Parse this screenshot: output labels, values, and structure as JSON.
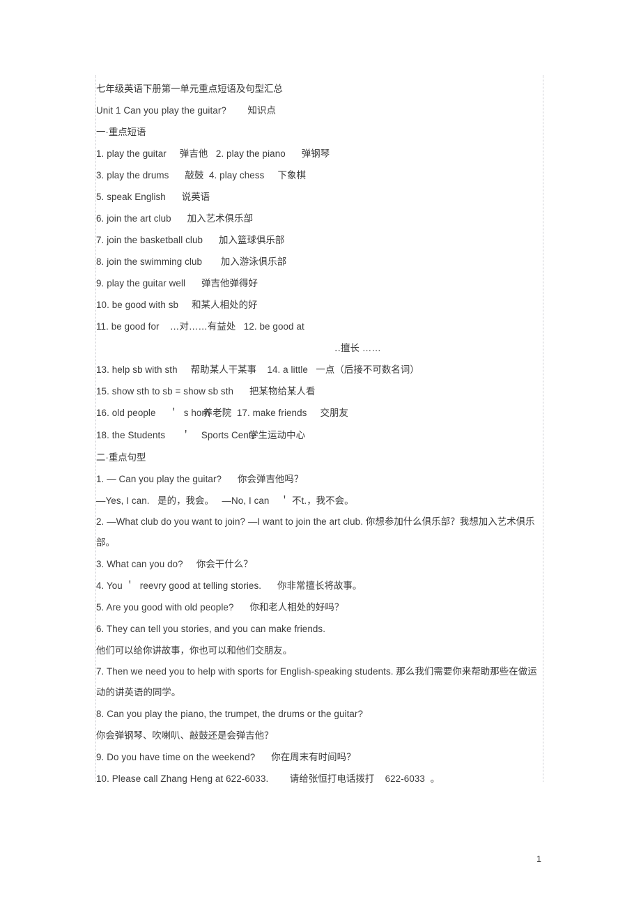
{
  "document": {
    "title": "七年级英语下册第一单元重点短语及句型汇总",
    "unit_heading": "Unit 1 Can you play the guitar?        知识点",
    "page_number": "1",
    "text_color": "#3a3a3a",
    "rule_color": "#c9c9cf",
    "background": "#ffffff"
  },
  "section_phrases": {
    "heading": "一·重点短语",
    "lines": [
      "1. play the guitar     弹吉他   2. play the piano      弹钢琴",
      "3. play the drums      敲鼓  4. play chess     下象棋",
      "5. speak English      说英语",
      "6. join the art club      加入艺术俱乐部",
      "7. join the basketball club      加入篮球俱乐部",
      "8. join the swimming club       加入游泳俱乐部",
      "9. play the guitar well      弹吉他弹得好",
      "10. be good with sb     和某人相处的好",
      "11. be good for    …对……有益处   12. be good at",
      "13. help sb with sth     帮助某人干某事    14. a little   一点（后接不可数名词）",
      "15. show sth to sb = show sb sth      把某物给某人看"
    ],
    "line_12_translation": "‥擅长 ……",
    "line_16": {
      "latin": "16. old people     ＇  s hom",
      "overlap_zh": "养老院",
      "tail": "  17. make friends     交朋友"
    },
    "line_18": {
      "latin": "18. the Students      ＇    Sports Cente",
      "overlap_zh": "学生运动中心"
    }
  },
  "section_sentences": {
    "heading": "二·重点句型",
    "items": [
      {
        "id": "s1a",
        "text": "1. — Can you play the guitar?      你会弹吉他吗？"
      },
      {
        "id": "s1b",
        "text": "—Yes, I can.   是的，我会。   —No, I can    ＇ 不t.，我不会。"
      },
      {
        "id": "s2",
        "text": "2. —What club do you want to join?       —I want to join the art club.      你想参加什么俱乐部？我想加入艺术俱乐部。"
      },
      {
        "id": "s3",
        "text": "3. What can you do?     你会干什么？"
      },
      {
        "id": "s4",
        "text": "4. You ＇  reevry good at telling stories.      你非常擅长将故事。"
      },
      {
        "id": "s5",
        "text": "5. Are you good with old people?      你和老人相处的好吗？"
      },
      {
        "id": "s6a",
        "text": "6. They can tell you stories, and you can make friends."
      },
      {
        "id": "s6b",
        "text": "他们可以给你讲故事，你也可以和他们交朋友。"
      },
      {
        "id": "s7",
        "text": "7. Then we need you to help with sports for English-speaking students.         那么我们需要你来帮助那些在做运动的讲英语的同学。"
      },
      {
        "id": "s8a",
        "text": "8. Can you play the piano, the trumpet, the drums or the guitar?"
      },
      {
        "id": "s8b",
        "text": "你会弹钢琴、吹喇叭、敲鼓还是会弹吉他？"
      },
      {
        "id": "s9",
        "text": "9. Do you have time on the weekend?      你在周末有时间吗？"
      },
      {
        "id": "s10",
        "text": "10. Please call Zhang Heng at 622-6033.        请给张恒打电话拨打    622-6033  。"
      }
    ]
  }
}
